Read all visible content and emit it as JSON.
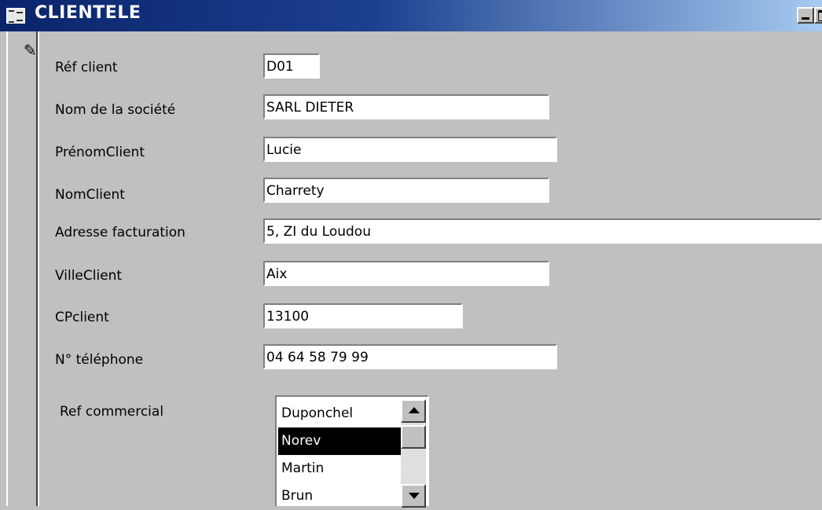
{
  "window": {
    "title": "CLIENTELE",
    "icon": "form-icon"
  },
  "record_selector": {
    "icon": "pencil-icon",
    "glyph": "✎"
  },
  "fields": {
    "ref_client": {
      "label": "Réf client",
      "value": "D01"
    },
    "nom_societe": {
      "label": "Nom de la société",
      "value": "SARL DIETER"
    },
    "prenom_client": {
      "label": "PrénomClient",
      "value": "Lucie"
    },
    "nom_client": {
      "label": "NomClient",
      "value": "Charrety"
    },
    "adresse_facturation": {
      "label": "Adresse facturation",
      "value": "5, ZI du Loudou"
    },
    "ville_client": {
      "label": "VilleClient",
      "value": "Aix"
    },
    "cp_client": {
      "label": "CPclient",
      "value": "13100"
    },
    "telephone": {
      "label": "N° téléphone",
      "value": "04 64 58 79 99"
    }
  },
  "ref_commercial": {
    "label": "Ref commercial",
    "options": [
      "Duponchel",
      "Norev",
      "Martin",
      "Brun"
    ],
    "selected": "Norev"
  },
  "colors": {
    "window_bg": "#c0c0c0",
    "titlebar_start": "#0a246a",
    "titlebar_end": "#a6caf0",
    "selection": "#000000"
  }
}
